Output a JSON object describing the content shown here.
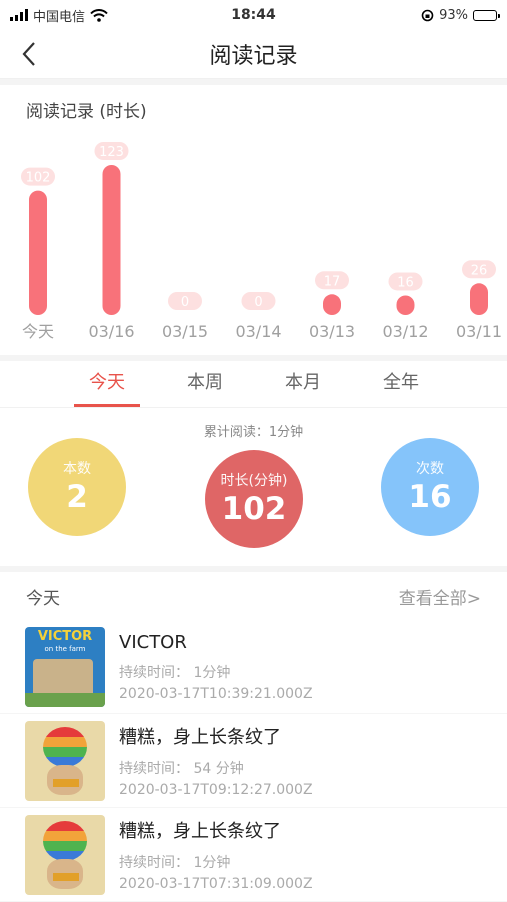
{
  "status_bar": {
    "carrier": "中国电信",
    "time": "18:44",
    "battery": "93%",
    "battery_level": 0.93
  },
  "nav": {
    "title": "阅读记录"
  },
  "chart_section": {
    "title": "阅读记录 (时长)"
  },
  "chart_data": {
    "type": "bar",
    "categories": [
      "今天",
      "03/16",
      "03/15",
      "03/14",
      "03/13",
      "03/12",
      "03/11"
    ],
    "values": [
      102,
      123,
      0,
      0,
      17,
      16,
      26
    ],
    "title": "阅读记录 (时长)",
    "bar_color": "#f8727a",
    "label_bg_color": "#fde0e0"
  },
  "tabs": [
    {
      "label": "今天",
      "active": true
    },
    {
      "label": "本周",
      "active": false
    },
    {
      "label": "本月",
      "active": false
    },
    {
      "label": "全年",
      "active": false
    }
  ],
  "summary": {
    "total": "累计阅读：1分钟",
    "books": {
      "label": "本数",
      "value": "2",
      "color": "#f1d777"
    },
    "duration": {
      "label": "时长(分钟)",
      "value": "102",
      "color": "#df6666"
    },
    "count": {
      "label": "次数",
      "value": "16",
      "color": "#85c4fa"
    }
  },
  "list": {
    "heading": "今天",
    "view_all": "查看全部>",
    "items": [
      {
        "title": "VICTOR",
        "duration": "持续时间：  1分钟",
        "timestamp": "2020-03-17T10:39:21.000Z",
        "cover_text": "VICTOR",
        "cover_subtext": "on the farm"
      },
      {
        "title": "糟糕，身上长条纹了",
        "duration": "持续时间：  54 分钟",
        "timestamp": "2020-03-17T09:12:27.000Z"
      },
      {
        "title": "糟糕，身上长条纹了",
        "duration": "持续时间：  1分钟",
        "timestamp": "2020-03-17T07:31:09.000Z"
      }
    ]
  },
  "icons": {
    "back": "chevron-left-icon",
    "wifi": "wifi-icon",
    "lock": "orientation-lock-icon"
  }
}
